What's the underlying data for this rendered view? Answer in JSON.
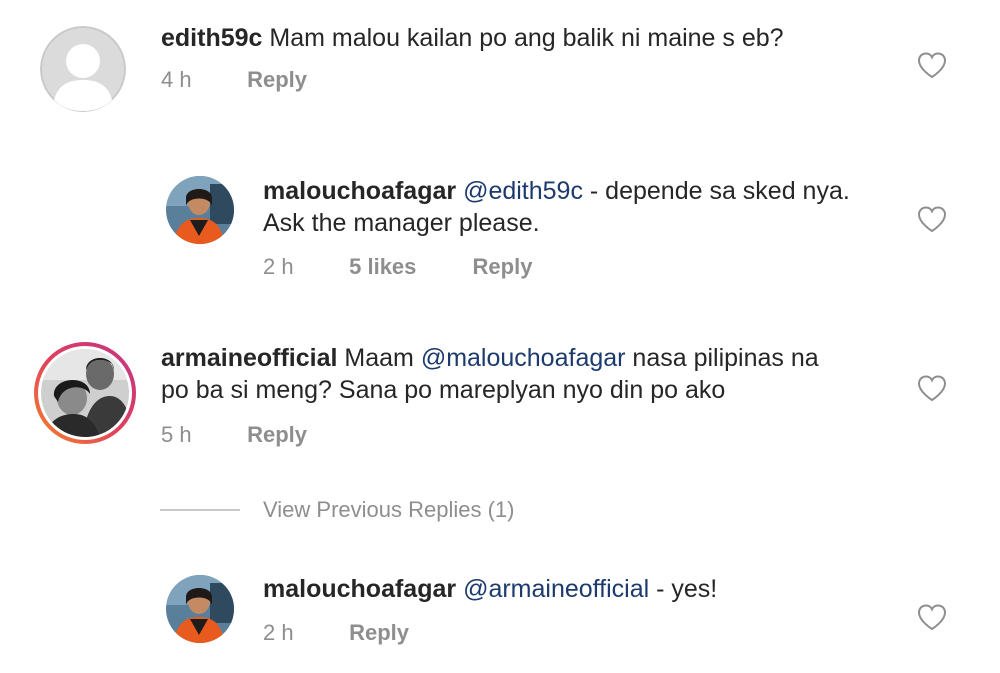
{
  "comments": [
    {
      "username": "edith59c",
      "text": "Mam malou kailan po ang balik ni maine s eb?",
      "time": "4 h",
      "reply_label": "Reply",
      "avatar_icon": "default-avatar-icon"
    },
    {
      "username": "malouchoafagar",
      "mention": "@edith59c",
      "text_line1_rest": " - depende sa sked nya.",
      "text_line2": "Ask the manager please.",
      "time": "2 h",
      "likes": "5 likes",
      "reply_label": "Reply"
    },
    {
      "username": "armaineofficial",
      "text_prefix": " Maam ",
      "mention": "@malouchoafagar",
      "text_line1_rest": " nasa pilipinas na",
      "text_line2": "po ba si meng? Sana po mareplyan nyo din po ako",
      "time": "5 h",
      "reply_label": "Reply"
    },
    {
      "username": "malouchoafagar",
      "mention": "@armaineofficial",
      "text_rest": " - yes!",
      "time": "2 h",
      "reply_label": "Reply"
    }
  ],
  "view_previous_replies": "View Previous Replies (1)",
  "colors": {
    "text": "#262626",
    "secondary": "#8e8e8e",
    "mention": "#1c3a6e",
    "story_ring_start": "#f58529",
    "story_ring_end": "#dd2a7b"
  },
  "icons": {
    "like": "heart-outline-icon"
  }
}
